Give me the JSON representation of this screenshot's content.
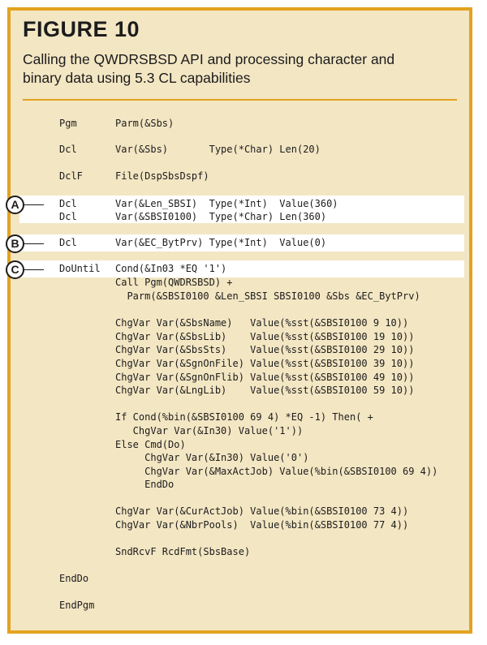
{
  "figure": {
    "title": "FIGURE 10",
    "caption_line1": "Calling the QWDRSBSD API and processing character and",
    "caption_line2": "binary data using 5.3 CL capabilities"
  },
  "markers": [
    "A",
    "B",
    "C"
  ],
  "code_lines": [
    {
      "cmd": "Pgm",
      "text": "Parm(&Sbs)"
    },
    {
      "cmd": "Dcl",
      "text": "Var(&Sbs)       Type(*Char) Len(20)"
    },
    {
      "cmd": "DclF",
      "text": "File(DspSbsDspf)"
    },
    {
      "cmd": "Dcl",
      "text": "Var(&Len_SBSI)  Type(*Int)  Value(360)"
    },
    {
      "cmd": "Dcl",
      "text": "Var(&SBSI0100)  Type(*Char) Len(360)"
    },
    {
      "cmd": "Dcl",
      "text": "Var(&EC_BytPrv) Type(*Int)  Value(0)"
    },
    {
      "cmd": "DoUntil",
      "text": "Cond(&In03 *EQ '1')"
    },
    {
      "cmd": "",
      "text": "Call Pgm(QWDRSBSD) +"
    },
    {
      "cmd": "",
      "text": "  Parm(&SBSI0100 &Len_SBSI SBSI0100 &Sbs &EC_BytPrv)"
    },
    {
      "cmd": "",
      "text": "ChgVar Var(&SbsName)   Value(%sst(&SBSI0100 9 10))"
    },
    {
      "cmd": "",
      "text": "ChgVar Var(&SbsLib)    Value(%sst(&SBSI0100 19 10))"
    },
    {
      "cmd": "",
      "text": "ChgVar Var(&SbsSts)    Value(%sst(&SBSI0100 29 10))"
    },
    {
      "cmd": "",
      "text": "ChgVar Var(&SgnOnFile) Value(%sst(&SBSI0100 39 10))"
    },
    {
      "cmd": "",
      "text": "ChgVar Var(&SgnOnFlib) Value(%sst(&SBSI0100 49 10))"
    },
    {
      "cmd": "",
      "text": "ChgVar Var(&LngLib)    Value(%sst(&SBSI0100 59 10))"
    },
    {
      "cmd": "",
      "text": "If Cond(%bin(&SBSI0100 69 4) *EQ -1) Then( +"
    },
    {
      "cmd": "",
      "text": "   ChgVar Var(&In30) Value('1'))"
    },
    {
      "cmd": "",
      "text": "Else Cmd(Do)"
    },
    {
      "cmd": "",
      "text": "     ChgVar Var(&In30) Value('0')"
    },
    {
      "cmd": "",
      "text": "     ChgVar Var(&MaxActJob) Value(%bin(&SBSI0100 69 4))"
    },
    {
      "cmd": "",
      "text": "     EndDo"
    },
    {
      "cmd": "",
      "text": "ChgVar Var(&CurActJob) Value(%bin(&SBSI0100 73 4))"
    },
    {
      "cmd": "",
      "text": "ChgVar Var(&NbrPools)  Value(%bin(&SBSI0100 77 4))"
    },
    {
      "cmd": "",
      "text": "SndRcvF RcdFmt(SbsBase)"
    },
    {
      "cmd": "EndDo",
      "text": ""
    },
    {
      "cmd": "EndPgm",
      "text": ""
    }
  ]
}
